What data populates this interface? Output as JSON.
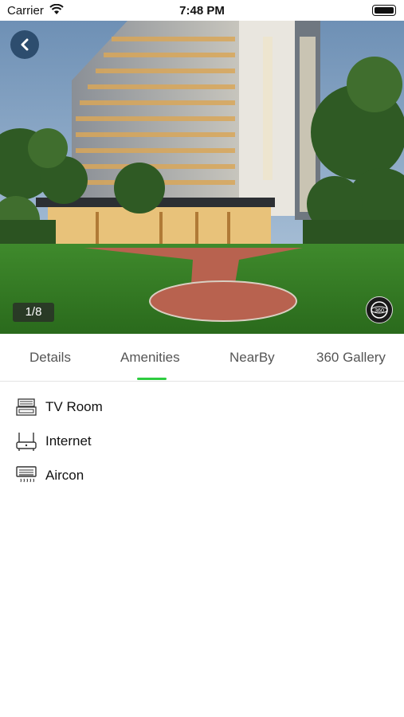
{
  "status_bar": {
    "carrier": "Carrier",
    "time": "7:48 PM"
  },
  "hero": {
    "photo_counter": "1/8",
    "view360_label": "360"
  },
  "tabs": [
    {
      "label": "Details",
      "active": false
    },
    {
      "label": "Amenities",
      "active": true
    },
    {
      "label": "NearBy",
      "active": false
    },
    {
      "label": "360 Gallery",
      "active": false
    }
  ],
  "amenities": [
    {
      "label": "TV Room",
      "icon": "tv-room-icon"
    },
    {
      "label": "Internet",
      "icon": "router-icon"
    },
    {
      "label": "Aircon",
      "icon": "aircon-icon"
    }
  ],
  "colors": {
    "accent": "#2ecc40",
    "back_button": "#2d4d6e"
  }
}
